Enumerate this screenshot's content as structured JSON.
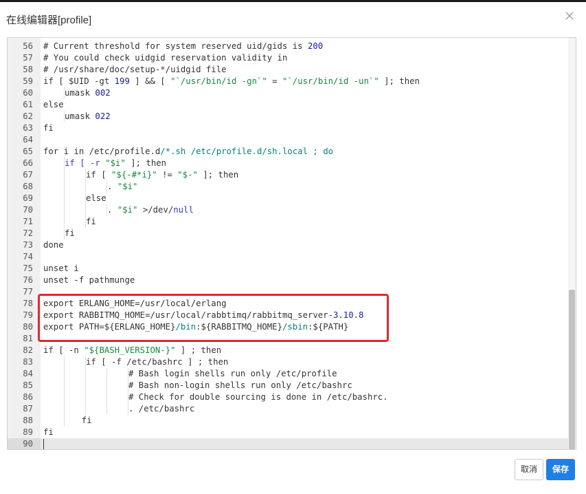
{
  "dialog": {
    "title": "在线编辑器[profile]",
    "close_icon": "close-icon",
    "cancel_label": "取消",
    "save_label": "保存",
    "accent_color": "#1e7fe6",
    "highlight_color": "#e0282e"
  },
  "editor": {
    "active_line": 90,
    "lines": [
      {
        "n": "56",
        "indent": 0,
        "tokens": [
          {
            "t": "# Current threshold for system reserved uid/gids is "
          },
          {
            "t": "200",
            "c": "num"
          }
        ]
      },
      {
        "n": "57",
        "indent": 0,
        "tokens": [
          {
            "t": "# You could check uidgid reservation validity in"
          }
        ]
      },
      {
        "n": "58",
        "indent": 0,
        "tokens": [
          {
            "t": "# /usr/share/doc/setup-*/uidgid file"
          }
        ]
      },
      {
        "n": "59",
        "indent": 0,
        "tokens": [
          {
            "t": "if [ $UID -gt "
          },
          {
            "t": "199",
            "c": "num"
          },
          {
            "t": " ] && [ "
          },
          {
            "t": "\"`/usr/bin/id -gn`\"",
            "c": "str"
          },
          {
            "t": " = "
          },
          {
            "t": "\"`/usr/bin/id -un`\"",
            "c": "str"
          },
          {
            "t": " ]; then"
          }
        ]
      },
      {
        "n": "60",
        "indent": 1,
        "tokens": [
          {
            "t": "umask "
          },
          {
            "t": "002",
            "c": "num"
          }
        ]
      },
      {
        "n": "61",
        "indent": 0,
        "tokens": [
          {
            "t": "else"
          }
        ]
      },
      {
        "n": "62",
        "indent": 1,
        "tokens": [
          {
            "t": "umask "
          },
          {
            "t": "022",
            "c": "num"
          }
        ]
      },
      {
        "n": "63",
        "indent": 0,
        "tokens": [
          {
            "t": "fi"
          }
        ]
      },
      {
        "n": "64",
        "indent": 0,
        "tokens": []
      },
      {
        "n": "65",
        "indent": 0,
        "tokens": [
          {
            "t": "for i in /etc/profile.d"
          },
          {
            "t": "/*.sh /etc/profile.d/sh.local ; do",
            "c": "var"
          }
        ]
      },
      {
        "n": "66",
        "indent": 1,
        "tokens": [
          {
            "t": "if [ -r ",
            "c": "kw"
          },
          {
            "t": "\"$i\"",
            "c": "str"
          },
          {
            "t": " ]; then"
          }
        ]
      },
      {
        "n": "67",
        "indent": 2,
        "tokens": [
          {
            "t": "if [ "
          },
          {
            "t": "\"${-#*i}\"",
            "c": "str"
          },
          {
            "t": " != "
          },
          {
            "t": "\"$-\"",
            "c": "str"
          },
          {
            "t": " ]; then"
          }
        ]
      },
      {
        "n": "68",
        "indent": 3,
        "tokens": [
          {
            "t": ". "
          },
          {
            "t": "\"$i\"",
            "c": "str"
          }
        ]
      },
      {
        "n": "69",
        "indent": 2,
        "tokens": [
          {
            "t": "else"
          }
        ]
      },
      {
        "n": "70",
        "indent": 3,
        "tokens": [
          {
            "t": ". "
          },
          {
            "t": "\"$i\"",
            "c": "str"
          },
          {
            "t": " >/dev/"
          },
          {
            "t": "null",
            "c": "kw"
          }
        ]
      },
      {
        "n": "71",
        "indent": 2,
        "tokens": [
          {
            "t": "fi"
          }
        ]
      },
      {
        "n": "72",
        "indent": 1,
        "tokens": [
          {
            "t": "fi"
          }
        ]
      },
      {
        "n": "73",
        "indent": 0,
        "tokens": [
          {
            "t": "done"
          }
        ]
      },
      {
        "n": "74",
        "indent": 0,
        "tokens": []
      },
      {
        "n": "75",
        "indent": 0,
        "tokens": [
          {
            "t": "unset i"
          }
        ]
      },
      {
        "n": "76",
        "indent": 0,
        "tokens": [
          {
            "t": "unset -f pathmunge"
          }
        ]
      },
      {
        "n": "77",
        "indent": 0,
        "tokens": []
      },
      {
        "n": "78",
        "indent": 0,
        "tokens": [
          {
            "t": "export ERLANG_HOME=/usr/local/erlang"
          }
        ]
      },
      {
        "n": "79",
        "indent": 0,
        "tokens": [
          {
            "t": "export RABBITMQ_HOME=/usr/local/rabbtimq/rabbitmq_server-"
          },
          {
            "t": "3.10.8",
            "c": "num"
          }
        ]
      },
      {
        "n": "80",
        "indent": 0,
        "tokens": [
          {
            "t": "export PATH=${ERLANG_HOME}"
          },
          {
            "t": "/bin",
            "c": "var"
          },
          {
            "t": ":${RABBITMQ_HOME}"
          },
          {
            "t": "/sbin",
            "c": "var"
          },
          {
            "t": ":${PATH}"
          }
        ]
      },
      {
        "n": "81",
        "indent": 0,
        "tokens": []
      },
      {
        "n": "82",
        "indent": 0,
        "tokens": [
          {
            "t": "if [ -n "
          },
          {
            "t": "\"${BASH_VERSION-}\"",
            "c": "str"
          },
          {
            "t": " ] ; then"
          }
        ]
      },
      {
        "n": "83",
        "indent": 2,
        "tokens": [
          {
            "t": "if [ -f /etc/bashrc ] ; then"
          }
        ]
      },
      {
        "n": "84",
        "indent": 4,
        "tokens": [
          {
            "t": "# Bash login shells run only /etc/profile"
          }
        ]
      },
      {
        "n": "85",
        "indent": 4,
        "tokens": [
          {
            "t": "# Bash non-login shells run only /etc/bashrc"
          }
        ]
      },
      {
        "n": "86",
        "indent": 4,
        "tokens": [
          {
            "t": "# Check for double sourcing is done in /etc/bashrc."
          }
        ]
      },
      {
        "n": "87",
        "indent": 4,
        "tokens": [
          {
            "t": ". /etc/bashrc"
          }
        ]
      },
      {
        "n": "88",
        "indent": 1.8,
        "tokens": [
          {
            "t": "fi"
          }
        ]
      },
      {
        "n": "89",
        "indent": 0,
        "tokens": [
          {
            "t": "fi"
          }
        ]
      },
      {
        "n": "90",
        "indent": 0,
        "tokens": []
      }
    ]
  }
}
